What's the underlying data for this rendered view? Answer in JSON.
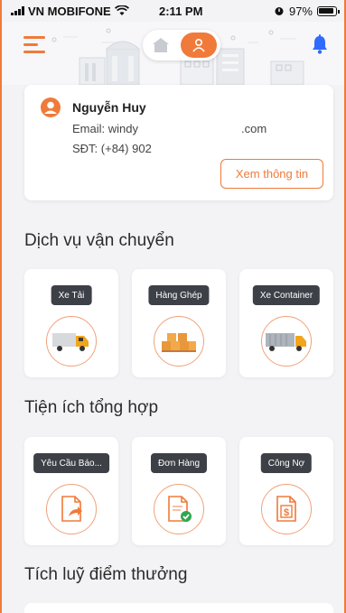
{
  "status_bar": {
    "carrier": "VN MOBIFONE",
    "time": "2:11 PM",
    "battery": "97%"
  },
  "header": {
    "menu_icon": "hamburger-menu-icon",
    "toggle_left_icon": "home-icon",
    "toggle_right_icon": "user-icon",
    "bell_icon": "bell-icon"
  },
  "profile": {
    "name": "Nguyễn Huy",
    "email_prefix": "Email: windy",
    "email_domain": ".com",
    "phone": "SĐT: (+84) 902",
    "view_button": "Xem thông tin"
  },
  "transport_section": {
    "title": "Dịch vụ vận chuyển",
    "items": [
      {
        "label": "Xe Tải",
        "icon": "truck-icon"
      },
      {
        "label": "Hàng Ghép",
        "icon": "boxes-icon"
      },
      {
        "label": "Xe Container",
        "icon": "container-truck-icon"
      }
    ]
  },
  "utility_section": {
    "title": "Tiện ích tổng hợp",
    "items": [
      {
        "label": "Yêu Cầu Báo...",
        "icon": "document-share-icon"
      },
      {
        "label": "Đơn Hàng",
        "icon": "document-check-icon"
      },
      {
        "label": "Công Nợ",
        "icon": "document-dollar-icon"
      }
    ]
  },
  "rewards_section": {
    "title": "Tích luỹ điểm thưởng"
  },
  "colors": {
    "accent": "#f07a3a",
    "pill": "#3d4147",
    "background": "#f3f3f5"
  }
}
